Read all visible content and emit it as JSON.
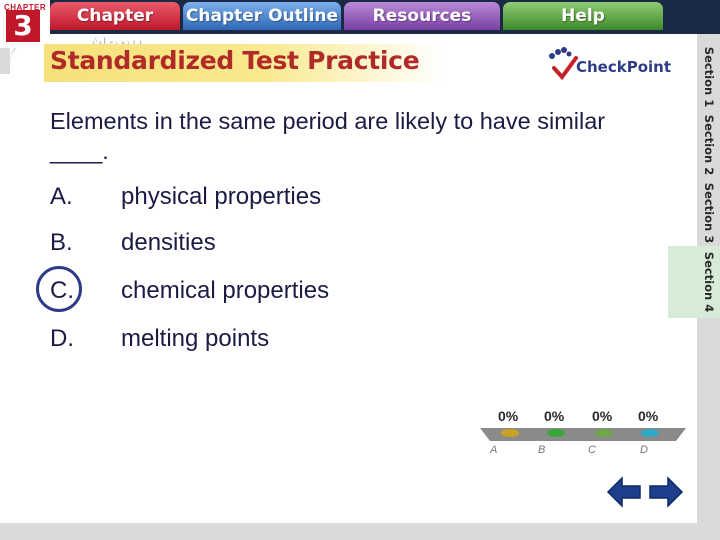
{
  "nav": {
    "chapter_word": "CHAPTER",
    "chapter_number": "3",
    "tabs": [
      {
        "label": "Chapter Menu",
        "color": "#c0172b"
      },
      {
        "label": "Chapter Outline",
        "color": "#2e67b6"
      },
      {
        "label": "Resources",
        "color": "#7a3fa4"
      },
      {
        "label": "Help",
        "color": "#3c8a2a"
      }
    ]
  },
  "header": {
    "title": "Standardized Test Practice",
    "logo_text": "CheckPoint"
  },
  "question": {
    "text": "Elements in the same period are likely to have similar ____.",
    "answers": [
      {
        "letter": "A.",
        "text": "physical properties"
      },
      {
        "letter": "B.",
        "text": "densities"
      },
      {
        "letter": "C.",
        "text": "chemical properties",
        "correct": true
      },
      {
        "letter": "D.",
        "text": "melting points"
      }
    ]
  },
  "sections": [
    "Section 1",
    "Section 2",
    "Section 3",
    "Section 4"
  ],
  "active_section": "Section 4",
  "responses": {
    "percents": [
      "0%",
      "0%",
      "0%",
      "0%"
    ],
    "labels": [
      "A",
      "B",
      "C",
      "D"
    ],
    "colors": [
      "#c9a227",
      "#3aa63a",
      "#6fa84a",
      "#2aa8c4"
    ]
  }
}
